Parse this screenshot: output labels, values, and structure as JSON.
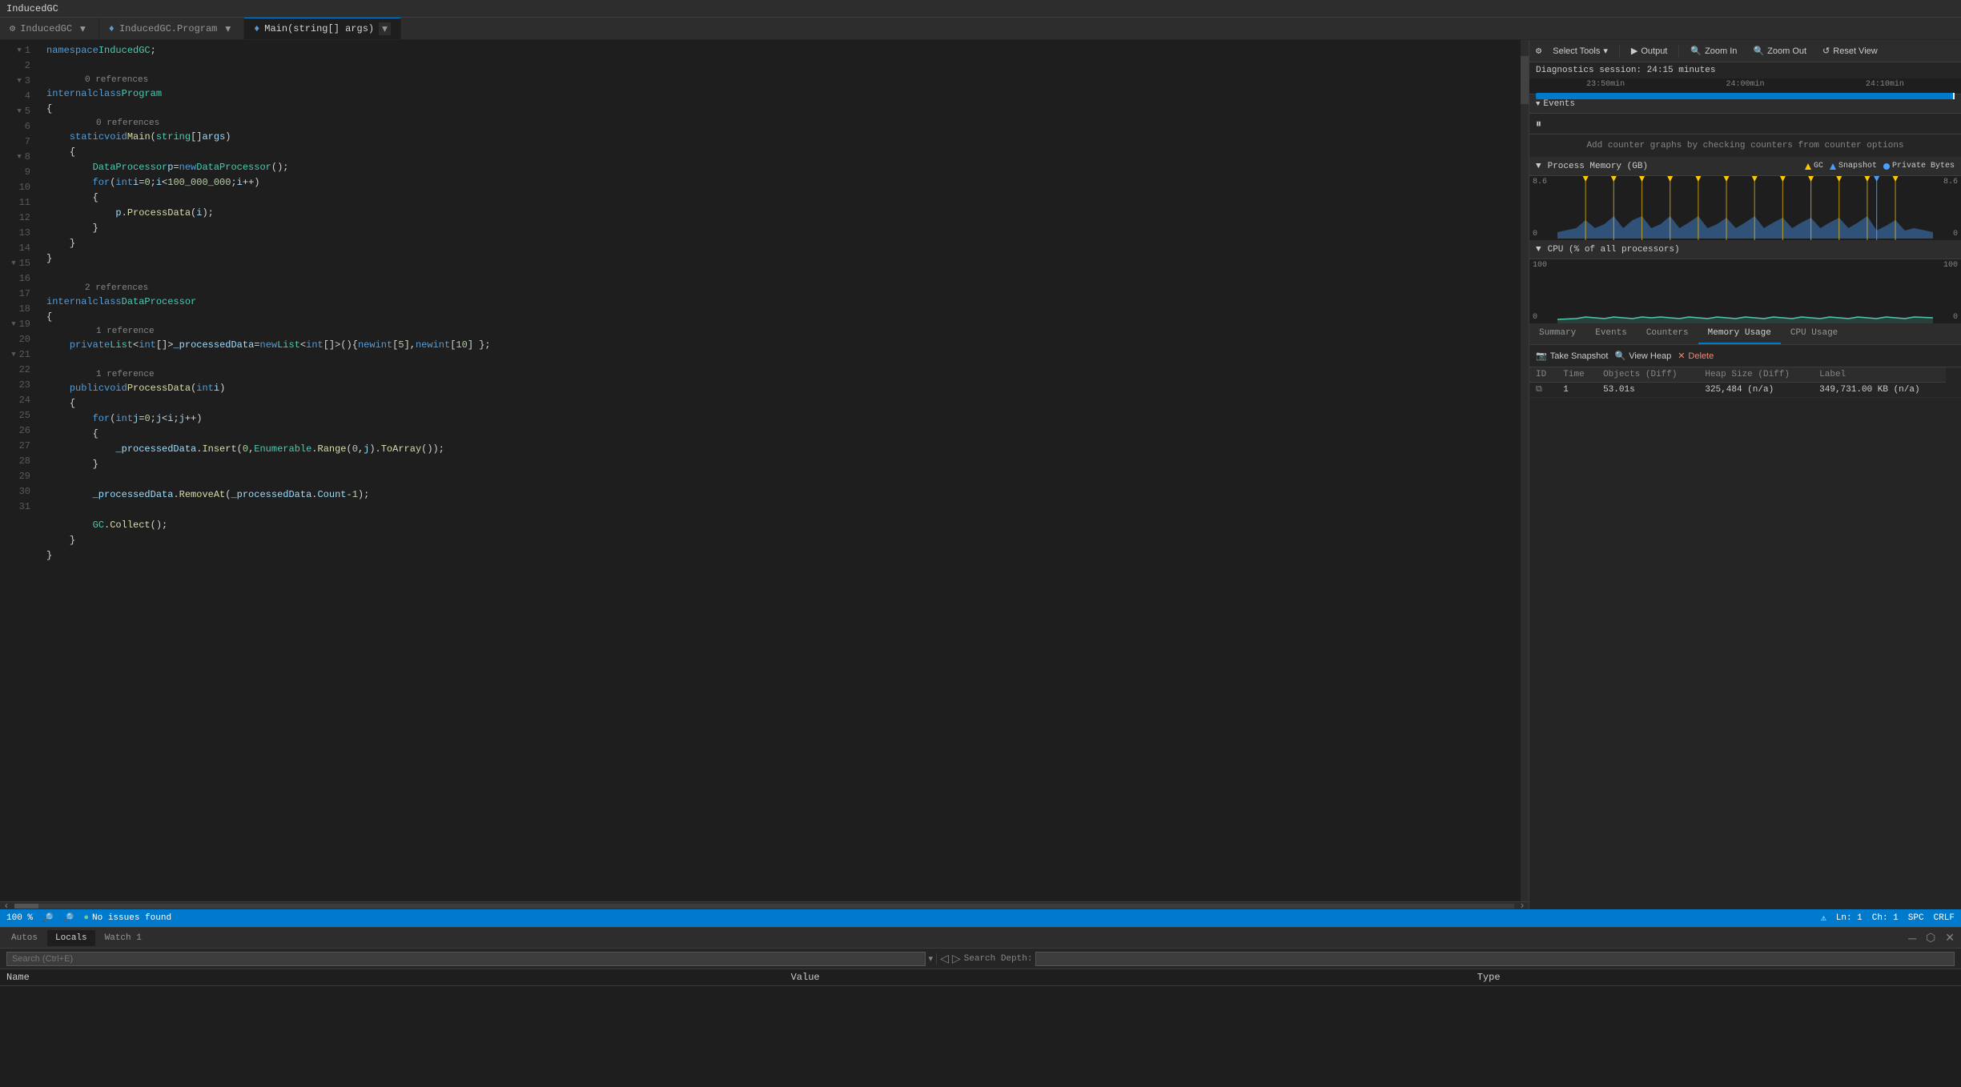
{
  "titleBar": {
    "title": "InducedGC"
  },
  "tabs": [
    {
      "label": "InducedGC",
      "icon": "⚙",
      "active": false
    },
    {
      "label": "InducedGC.Program",
      "icon": "♦",
      "active": false
    },
    {
      "label": "Main(string[] args)",
      "icon": "♦",
      "active": true
    }
  ],
  "codeLines": [
    {
      "num": 1,
      "indent": 0,
      "content": "namespace InducedGC;",
      "collapse": false,
      "hasCollapse": false
    },
    {
      "num": 2,
      "indent": 0,
      "content": "",
      "collapse": false
    },
    {
      "num": 3,
      "indent": 0,
      "content": "internal class Program",
      "collapse": true,
      "ref": "0 references"
    },
    {
      "num": 4,
      "indent": 0,
      "content": "{",
      "collapse": false
    },
    {
      "num": 5,
      "indent": 1,
      "content": "static void Main(string[] args)",
      "collapse": true,
      "ref": "0 references"
    },
    {
      "num": 6,
      "indent": 1,
      "content": "{",
      "collapse": false
    },
    {
      "num": 7,
      "indent": 2,
      "content": "DataProcessor p = new DataProcessor();",
      "collapse": false
    },
    {
      "num": 8,
      "indent": 2,
      "content": "for (int i = 0; i < 100_000_000; i++)",
      "collapse": true
    },
    {
      "num": 9,
      "indent": 2,
      "content": "{",
      "collapse": false
    },
    {
      "num": 10,
      "indent": 3,
      "content": "p.ProcessData(i);",
      "collapse": false
    },
    {
      "num": 11,
      "indent": 2,
      "content": "}",
      "collapse": false
    },
    {
      "num": 12,
      "indent": 1,
      "content": "}",
      "collapse": false
    },
    {
      "num": 13,
      "indent": 0,
      "content": "}",
      "collapse": false
    },
    {
      "num": 14,
      "indent": 0,
      "content": "",
      "collapse": false
    },
    {
      "num": 15,
      "indent": 0,
      "content": "internal class DataProcessor",
      "collapse": true,
      "ref": "2 references"
    },
    {
      "num": 16,
      "indent": 0,
      "content": "{",
      "collapse": false
    },
    {
      "num": 17,
      "indent": 1,
      "content": "private List<int[]> _processedData = new List<int[]>() { new int[5], new int[10] };",
      "ref": "1 reference"
    },
    {
      "num": 18,
      "indent": 1,
      "content": "",
      "collapse": false
    },
    {
      "num": 19,
      "indent": 1,
      "content": "public void ProcessData(int i)",
      "collapse": true,
      "ref": "1 reference"
    },
    {
      "num": 20,
      "indent": 1,
      "content": "{",
      "collapse": false
    },
    {
      "num": 21,
      "indent": 2,
      "content": "for (int j = 0; j < i; j++)",
      "collapse": true
    },
    {
      "num": 22,
      "indent": 2,
      "content": "{",
      "collapse": false
    },
    {
      "num": 23,
      "indent": 3,
      "content": "_processedData.Insert(0, Enumerable.Range(0, j).ToArray());",
      "collapse": false
    },
    {
      "num": 24,
      "indent": 2,
      "content": "}",
      "collapse": false
    },
    {
      "num": 25,
      "indent": 2,
      "content": "",
      "collapse": false
    },
    {
      "num": 26,
      "indent": 2,
      "content": "_processedData.RemoveAt(_processedData.Count - 1);",
      "collapse": false
    },
    {
      "num": 27,
      "indent": 2,
      "content": "",
      "collapse": false
    },
    {
      "num": 28,
      "indent": 2,
      "content": "GC.Collect();",
      "collapse": false
    },
    {
      "num": 29,
      "indent": 1,
      "content": "}",
      "collapse": false
    },
    {
      "num": 30,
      "indent": 0,
      "content": "}",
      "collapse": false
    },
    {
      "num": 31,
      "indent": 0,
      "content": "",
      "collapse": false
    }
  ],
  "statusBar": {
    "zoom": "100 %",
    "noIssues": "No issues found",
    "lineCol": "Ln: 1",
    "ch": "Ch: 1",
    "spc": "SPC",
    "crlf": "CRLF"
  },
  "diagnostics": {
    "toolbar": {
      "selectTools": "Select Tools",
      "output": "Output",
      "zoomIn": "Zoom In",
      "zoomOut": "Zoom Out",
      "resetView": "Reset View"
    },
    "session": "Diagnostics session: 24:15 minutes",
    "timeline": {
      "t1": "23:50min",
      "t2": "24:00min",
      "t3": "24:10min"
    },
    "events": {
      "header": "Events",
      "counterNote": "Add counter graphs by checking counters from counter options"
    },
    "processMemory": {
      "header": "Process Memory (GB)",
      "maxY": "8.6",
      "minY": "0",
      "legend": {
        "gc": "GC",
        "snapshot": "Snapshot",
        "privateBytes": "Private Bytes"
      }
    },
    "cpu": {
      "header": "CPU (% of all processors)",
      "maxY": "100",
      "minY": "0"
    },
    "tabs": {
      "summary": "Summary",
      "events": "Events",
      "counters": "Counters",
      "memoryUsage": "Memory Usage",
      "cpuUsage": "CPU Usage"
    },
    "snapshotToolbar": {
      "takeSnapshot": "Take Snapshot",
      "viewHeap": "View Heap",
      "delete": "Delete"
    },
    "table": {
      "headers": [
        "ID",
        "Time",
        "Objects (Diff)",
        "Heap Size (Diff)",
        "Label"
      ],
      "rows": [
        {
          "id": "1",
          "time": "53.01s",
          "objects": "325,484 (n/a)",
          "heapSize": "349,731.00 KB (n/a)",
          "label": ""
        }
      ]
    }
  },
  "bottomPanel": {
    "tabs": [
      "Autos",
      "Locals",
      "Watch 1"
    ],
    "activeTab": "Locals",
    "search": {
      "placeholder": "Search (Ctrl+E)",
      "depthLabel": "Search Depth:"
    },
    "tableHeaders": [
      "Name",
      "Value",
      "Type"
    ]
  }
}
